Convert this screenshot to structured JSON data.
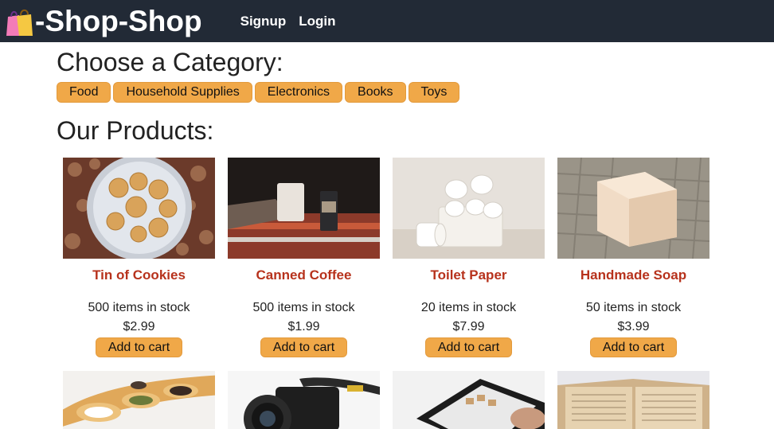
{
  "header": {
    "brand": "-Shop-Shop",
    "nav": [
      "Signup",
      "Login"
    ]
  },
  "categories_title": "Choose a Category:",
  "categories": [
    "Food",
    "Household Supplies",
    "Electronics",
    "Books",
    "Toys"
  ],
  "products_title": "Our Products:",
  "products": [
    {
      "name": "Tin of Cookies",
      "stock": "500 items in stock",
      "price": "$2.99",
      "button": "Add to cart",
      "image": "cookies-photo"
    },
    {
      "name": "Canned Coffee",
      "stock": "500 items in stock",
      "price": "$1.99",
      "button": "Add to cart",
      "image": "coffee-photo"
    },
    {
      "name": "Toilet Paper",
      "stock": "20 items in stock",
      "price": "$7.99",
      "button": "Add to cart",
      "image": "toilet-paper-photo"
    },
    {
      "name": "Handmade Soap",
      "stock": "50 items in stock",
      "price": "$3.99",
      "button": "Add to cart",
      "image": "soap-photo"
    }
  ],
  "next_row_images": [
    "spices-photo",
    "camera-photo",
    "tablet-photo",
    "book-photo"
  ],
  "colors": {
    "header_bg": "#222a36",
    "accent": "#f0a848",
    "product_name": "#b7321c"
  }
}
